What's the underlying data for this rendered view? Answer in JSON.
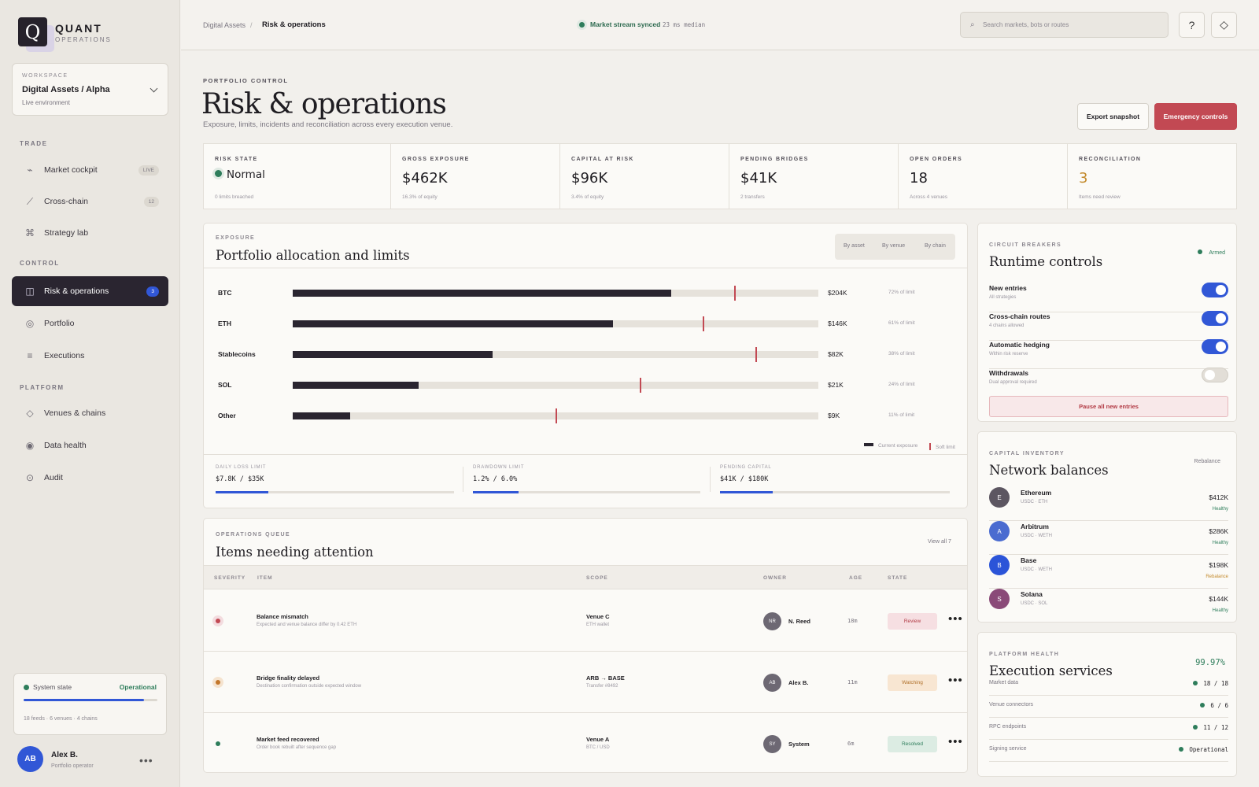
{
  "brand": {
    "logo": "Q",
    "name": "QUANT",
    "sub": "OPERATIONS"
  },
  "workspace": {
    "label": "WORKSPACE",
    "name": "Digital Assets / Alpha",
    "env": "Live environment"
  },
  "sidebar": {
    "sections": [
      "TRADE",
      "CONTROL",
      "PLATFORM"
    ],
    "items": [
      {
        "label": "Market cockpit",
        "badge": "LIVE",
        "icon": "pulse-icon"
      },
      {
        "label": "Cross-chain",
        "badge": "12",
        "icon": "route-icon"
      },
      {
        "label": "Strategy lab",
        "badge": "",
        "icon": "command-icon"
      },
      {
        "label": "Risk & operations",
        "badge": "3",
        "icon": "layout-icon"
      },
      {
        "label": "Portfolio",
        "badge": "",
        "icon": "ring-icon"
      },
      {
        "label": "Executions",
        "badge": "",
        "icon": "list-icon"
      },
      {
        "label": "Venues & chains",
        "badge": "",
        "icon": "diamond-icon"
      },
      {
        "label": "Data health",
        "badge": "",
        "icon": "target-icon"
      },
      {
        "label": "Audit",
        "badge": "",
        "icon": "clock-icon"
      }
    ],
    "system": {
      "label": "System state",
      "value": "Operational",
      "health": 0.9,
      "meta": "18 feeds · 6 venues · 4 chains"
    },
    "user": {
      "initials": "AB",
      "name": "Alex B.",
      "role": "Portfolio operator",
      "more": "•••"
    }
  },
  "topbar": {
    "crumbs": [
      "Digital Assets",
      "/",
      "Risk & operations"
    ],
    "stream": "Market stream synced",
    "latency": "23 ms median",
    "search_placeholder": "Search markets, bots or routes",
    "help": "?",
    "alert_icon": "diamond-icon"
  },
  "header": {
    "eyebrow": "PORTFOLIO CONTROL",
    "title": "Risk & operations",
    "subtitle": "Exposure, limits, incidents and reconciliation across every execution venue.",
    "export": "Export snapshot",
    "emergency": "Emergency controls"
  },
  "kpis": [
    {
      "label": "RISK STATE",
      "value": "Normal",
      "sub": "0 limits breached"
    },
    {
      "label": "GROSS EXPOSURE",
      "value": "$462K",
      "sub": "16.3% of equity"
    },
    {
      "label": "CAPITAL AT RISK",
      "value": "$96K",
      "sub": "3.4% of equity"
    },
    {
      "label": "PENDING BRIDGES",
      "value": "$41K",
      "sub": "2 transfers"
    },
    {
      "label": "OPEN ORDERS",
      "value": "18",
      "sub": "Across 4 venues"
    },
    {
      "label": "RECONCILIATION",
      "value": "3",
      "sub": "Items need review"
    }
  ],
  "exposure": {
    "eyebrow": "EXPOSURE",
    "title": "Portfolio allocation and limits",
    "tabs": [
      "By asset",
      "By venue",
      "By chain"
    ],
    "rows": [
      {
        "name": "BTC",
        "fill": 0.72,
        "limit": 0.84,
        "value": "$204K",
        "pct": "72% of limit"
      },
      {
        "name": "ETH",
        "fill": 0.61,
        "limit": 0.78,
        "value": "$146K",
        "pct": "61% of limit"
      },
      {
        "name": "Stablecoins",
        "fill": 0.38,
        "limit": 0.88,
        "value": "$82K",
        "pct": "38% of limit"
      },
      {
        "name": "SOL",
        "fill": 0.24,
        "limit": 0.66,
        "value": "$21K",
        "pct": "24% of limit"
      },
      {
        "name": "Other",
        "fill": 0.11,
        "limit": 0.5,
        "value": "$9K",
        "pct": "11% of limit"
      }
    ],
    "legend": [
      "Current exposure",
      "Soft limit"
    ],
    "limits": [
      {
        "label": "DAILY LOSS LIMIT",
        "value": "$7.8K / $35K",
        "fill": 0.22
      },
      {
        "label": "DRAWDOWN LIMIT",
        "value": "1.2% / 6.0%",
        "fill": 0.2
      },
      {
        "label": "PENDING CAPITAL",
        "value": "$41K / $180K",
        "fill": 0.23
      }
    ]
  },
  "breakers": {
    "eyebrow": "CIRCUIT BREAKERS",
    "title": "Runtime controls",
    "status": "Armed",
    "toggles": [
      {
        "title": "New entries",
        "sub": "All strategies",
        "on": true
      },
      {
        "title": "Cross-chain routes",
        "sub": "4 chains allowed",
        "on": true
      },
      {
        "title": "Automatic hedging",
        "sub": "Within risk reserve",
        "on": true
      },
      {
        "title": "Withdrawals",
        "sub": "Dual approval required",
        "on": false
      }
    ],
    "pause": "Pause all new entries"
  },
  "network": {
    "eyebrow": "CAPITAL INVENTORY",
    "title": "Network balances",
    "action": "Rebalance",
    "rows": [
      {
        "initial": "E",
        "name": "Ethereum",
        "sub": "USDC · ETH",
        "value": "$412K",
        "status": "Healthy",
        "color": "#5c5661",
        "scolor": "#2e7d5b"
      },
      {
        "initial": "A",
        "name": "Arbitrum",
        "sub": "USDC · WETH",
        "value": "$286K",
        "status": "Healthy",
        "color": "#4a6bd0",
        "scolor": "#2e7d5b"
      },
      {
        "initial": "B",
        "name": "Base",
        "sub": "USDC · WETH",
        "value": "$198K",
        "status": "Rebalance",
        "color": "#2b54d8",
        "scolor": "#c38a2c"
      },
      {
        "initial": "S",
        "name": "Solana",
        "sub": "USDC · SOL",
        "value": "$144K",
        "status": "Healthy",
        "color": "#8a4a78",
        "scolor": "#2e7d5b"
      }
    ]
  },
  "health": {
    "eyebrow": "PLATFORM HEALTH",
    "title": "Execution services",
    "uptime": "99.97%",
    "rows": [
      {
        "name": "Market data",
        "value": "18 / 18"
      },
      {
        "name": "Venue connectors",
        "value": "6 / 6"
      },
      {
        "name": "RPC endpoints",
        "value": "11 / 12"
      },
      {
        "name": "Signing service",
        "value": "Operational"
      }
    ]
  },
  "queue": {
    "eyebrow": "OPERATIONS QUEUE",
    "title": "Items needing attention",
    "view_all": "View all 7",
    "columns": [
      "SEVERITY",
      "ITEM",
      "SCOPE",
      "OWNER",
      "AGE",
      "STATE"
    ],
    "rows": [
      {
        "title": "Balance mismatch",
        "sub": "Expected and venue balance differ by 0.42 ETH",
        "scope": "Venue C",
        "scope_sub": "ETH wallet",
        "owner_initials": "NR",
        "owner": "N. Reed",
        "age": "18m",
        "state": "Review",
        "sev": "#c24953",
        "sevbg": "#f3dcdf",
        "stbg": "#f6dfe2",
        "stc": "#b23b45"
      },
      {
        "title": "Bridge finality delayed",
        "sub": "Destination confirmation outside expected window",
        "scope": "ARB → BASE",
        "scope_sub": "Transfer #8492",
        "owner_initials": "AB",
        "owner": "Alex B.",
        "age": "11m",
        "state": "Watching",
        "sev": "#c3772c",
        "sevbg": "#f5e3cf",
        "stbg": "#f8e6d2",
        "stc": "#b0712c"
      },
      {
        "title": "Market feed recovered",
        "sub": "Order book rebuilt after sequence gap",
        "scope": "Venue A",
        "scope_sub": "BTC / USD",
        "owner_initials": "SY",
        "owner": "System",
        "age": "6m",
        "state": "Resolved",
        "sev": "#2e7d5b",
        "sevbg": "transparent",
        "stbg": "#dcece3",
        "stc": "#2e7d5b"
      }
    ],
    "more": "•••"
  }
}
